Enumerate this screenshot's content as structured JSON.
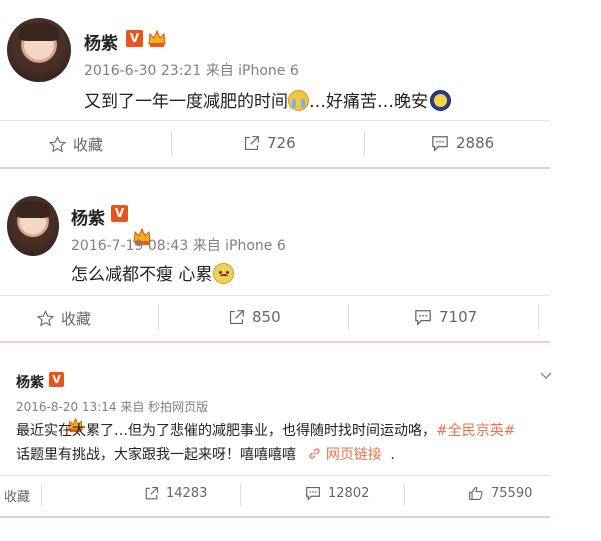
{
  "posts": [
    {
      "author": "杨紫",
      "verified": "V",
      "meta": "2016-6-30 23:21 来自 iPhone 6",
      "text_a": "又到了一年一度减肥的时间",
      "text_b": "…好痛苦…晚安",
      "actions": {
        "favorite": "收藏",
        "repost": "726",
        "comment": "2886"
      }
    },
    {
      "author": "杨紫",
      "verified": "V",
      "meta": "2016-7-19 08:43 来自 iPhone 6",
      "text_a": "怎么减都不瘦 心累",
      "actions": {
        "favorite": "收藏",
        "repost": "850",
        "comment": "7107"
      }
    },
    {
      "author": "杨紫",
      "verified": "V",
      "meta": "2016-8-20 13:14 来自 秒拍网页版",
      "line1": "最近实在太累了…但为了悲催的减肥事业，也得随时找时间运动咯，",
      "topic": "#全民京英#",
      "line2": "话题里有挑战，大家跟我一起来呀！嘻嘻嘻嘻",
      "link_label": "网页链接",
      "line2_end": ".",
      "actions": {
        "favorite": "收藏",
        "repost": "14283",
        "comment": "12802",
        "like": "75590"
      }
    }
  ],
  "colors": {
    "accent": "#eb7350",
    "verified_badge": "#e8541e",
    "divider_pink": "#f3c9cf"
  }
}
